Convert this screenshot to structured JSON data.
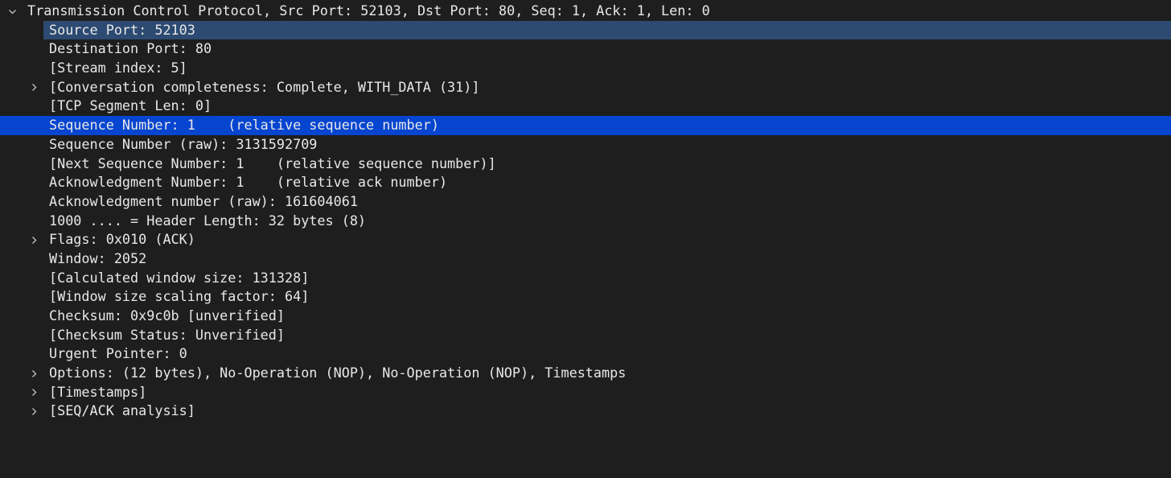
{
  "tree": {
    "root": {
      "label": "Transmission Control Protocol, Src Port: 52103, Dst Port: 80, Seq: 1, Ack: 1, Len: 0",
      "expanded": true
    },
    "fields": [
      {
        "label": "Source Port: 52103",
        "expandable": false
      },
      {
        "label": "Destination Port: 80",
        "expandable": false
      },
      {
        "label": "[Stream index: 5]",
        "expandable": false
      },
      {
        "label": "[Conversation completeness: Complete, WITH_DATA (31)]",
        "expandable": true
      },
      {
        "label": "[TCP Segment Len: 0]",
        "expandable": false
      },
      {
        "label": "Sequence Number: 1    (relative sequence number)",
        "expandable": false,
        "selected": true
      },
      {
        "label": "Sequence Number (raw): 3131592709",
        "expandable": false
      },
      {
        "label": "[Next Sequence Number: 1    (relative sequence number)]",
        "expandable": false
      },
      {
        "label": "Acknowledgment Number: 1    (relative ack number)",
        "expandable": false
      },
      {
        "label": "Acknowledgment number (raw): 161604061",
        "expandable": false
      },
      {
        "label": "1000 .... = Header Length: 32 bytes (8)",
        "expandable": false
      },
      {
        "label": "Flags: 0x010 (ACK)",
        "expandable": true
      },
      {
        "label": "Window: 2052",
        "expandable": false
      },
      {
        "label": "[Calculated window size: 131328]",
        "expandable": false
      },
      {
        "label": "[Window size scaling factor: 64]",
        "expandable": false
      },
      {
        "label": "Checksum: 0x9c0b [unverified]",
        "expandable": false
      },
      {
        "label": "[Checksum Status: Unverified]",
        "expandable": false
      },
      {
        "label": "Urgent Pointer: 0",
        "expandable": false
      },
      {
        "label": "Options: (12 bytes), No-Operation (NOP), No-Operation (NOP), Timestamps",
        "expandable": true
      },
      {
        "label": "[Timestamps]",
        "expandable": true
      },
      {
        "label": "[SEQ/ACK analysis]",
        "expandable": true
      }
    ]
  },
  "colors": {
    "background": "#1e1e1e",
    "text": "#e8e8e8",
    "hover_row": "#2c4a72",
    "selected_row": "#0645d0"
  },
  "icons": {
    "expanded": "chevron-down-icon",
    "collapsed": "chevron-right-icon"
  }
}
